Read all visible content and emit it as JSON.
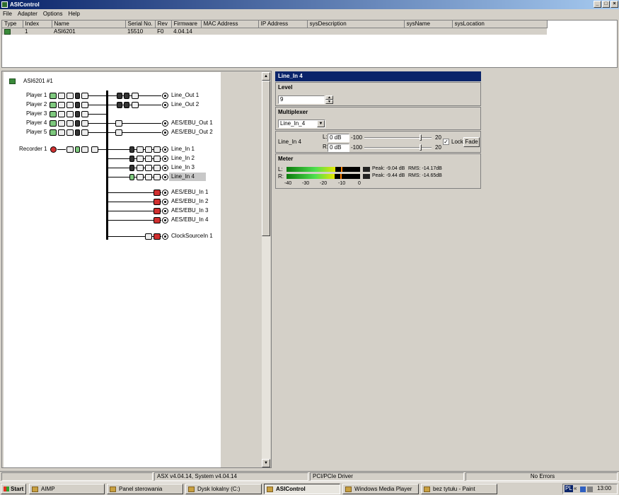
{
  "window": {
    "title": "ASIControl",
    "btn_min": "_",
    "btn_max": "□",
    "btn_close": "×"
  },
  "menu": [
    "File",
    "Adapter",
    "Options",
    "Help"
  ],
  "device_table": {
    "columns": [
      "Type",
      "Index",
      "Name",
      "Serial No.",
      "Rev",
      "Firmware",
      "MAC Address",
      "IP Address",
      "sysDescription",
      "sysName",
      "sysLocation"
    ],
    "rows": [
      {
        "index": "1",
        "name": "ASI6201",
        "serial": "15510",
        "rev": "F0",
        "firmware": "4.04.14",
        "mac": "",
        "ip": "",
        "desc": "",
        "sysname": "",
        "location": ""
      }
    ]
  },
  "tree": {
    "adapter": "ASI6201 #1",
    "players": [
      "Player  1",
      "Player  2",
      "Player  3",
      "Player  4",
      "Player  5"
    ],
    "recorder": "Recorder  1",
    "outputs": [
      "Line_Out  1",
      "Line_Out  2",
      "AES/EBU_Out  1",
      "AES/EBU_Out  2"
    ],
    "inputs": [
      "Line_In  1",
      "Line_In  2",
      "Line_In  3",
      "Line_In  4"
    ],
    "aes_inputs": [
      "AES/EBU_In  1",
      "AES/EBU_In  2",
      "AES/EBU_In  3",
      "AES/EBU_In  4"
    ],
    "clock": "ClockSourceIn  1"
  },
  "panel": {
    "title": "Line_In  4",
    "level_label": "Level",
    "level_value": "9",
    "mux_label": "Multiplexer",
    "mux_value": "Line_In_4",
    "vol_label": "Line_In  4",
    "l_label": "L:",
    "r_label": "R:",
    "l_value": "0 dB",
    "r_value": "0 dB",
    "min": "-100",
    "max": "20",
    "lock_label": "Lock",
    "lock_checked": true,
    "fade_label": "Fade",
    "meter_label": "Meter",
    "meter": {
      "l_peak": "Peak: -9.04 dB",
      "l_rms": "RMS: -14.17dB",
      "r_peak": "Peak: -9.44 dB",
      "r_rms": "RMS: -14.65dB",
      "l_level_db": -9.04,
      "r_level_db": -9.44,
      "scale": [
        "-40",
        "-30",
        "-20",
        "-10",
        "0"
      ]
    }
  },
  "status": {
    "version": "ASX v4.04.14, System v4.04.14",
    "driver": "PCI/PCIe Driver",
    "errors": "No Errors"
  },
  "taskbar": {
    "start": "Start",
    "items": [
      "AIMP",
      "Panel sterowania",
      "Dysk lokalny (C:)",
      "ASIControl",
      "Windows Media Player",
      "bez tytułu - Paint"
    ],
    "lang": "PL",
    "time": "13:00"
  }
}
